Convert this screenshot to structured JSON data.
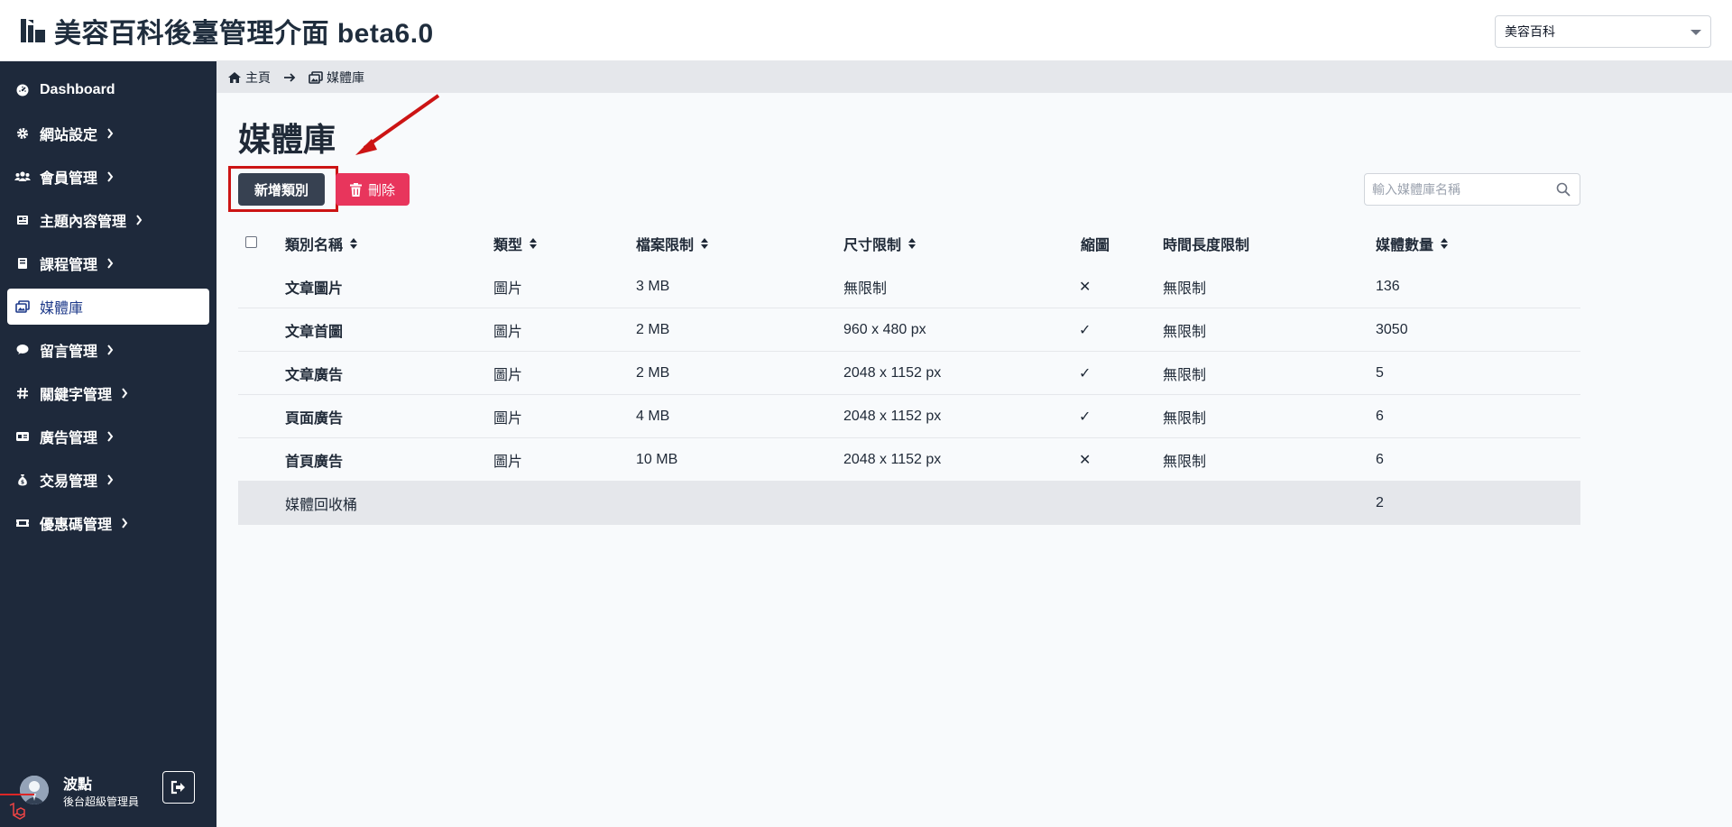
{
  "app": {
    "title": "美容百科後臺管理介面 beta6.0",
    "site_selector": {
      "value": "美容百科"
    }
  },
  "sidebar": {
    "items": [
      {
        "label": "Dashboard",
        "icon": "dashboard-icon",
        "has_children": false
      },
      {
        "label": "網站設定",
        "icon": "gear-icon",
        "has_children": true
      },
      {
        "label": "會員管理",
        "icon": "users-icon",
        "has_children": true
      },
      {
        "label": "主題內容管理",
        "icon": "book-icon",
        "has_children": true
      },
      {
        "label": "課程管理",
        "icon": "course-icon",
        "has_children": true
      },
      {
        "label": "媒體庫",
        "icon": "images-icon",
        "has_children": false,
        "active": true
      },
      {
        "label": "留言管理",
        "icon": "comment-icon",
        "has_children": true
      },
      {
        "label": "關鍵字管理",
        "icon": "hashtag-icon",
        "has_children": true
      },
      {
        "label": "廣告管理",
        "icon": "ad-icon",
        "has_children": true
      },
      {
        "label": "交易管理",
        "icon": "money-bag-icon",
        "has_children": true
      },
      {
        "label": "優惠碼管理",
        "icon": "ticket-icon",
        "has_children": true
      }
    ],
    "user": {
      "name": "波點",
      "role": "後台超級管理員"
    }
  },
  "breadcrumb": [
    {
      "label": "主頁",
      "icon": "home-icon"
    },
    {
      "label": "媒體庫",
      "icon": "images-icon"
    }
  ],
  "main": {
    "title": "媒體庫",
    "add_button": "新增類別",
    "delete_button": "刪除",
    "search": {
      "placeholder": "輸入媒體庫名稱",
      "value": ""
    }
  },
  "table": {
    "columns": [
      "類別名稱",
      "類型",
      "檔案限制",
      "尺寸限制",
      "縮圖",
      "時間長度限制",
      "媒體數量"
    ],
    "sortable": [
      true,
      true,
      true,
      true,
      false,
      false,
      true
    ],
    "rows": [
      {
        "name": "文章圖片",
        "type": "圖片",
        "file_limit": "3 MB",
        "size_limit": "無限制",
        "thumbnail": "✕",
        "duration_limit": "無限制",
        "count": "136"
      },
      {
        "name": "文章首圖",
        "type": "圖片",
        "file_limit": "2 MB",
        "size_limit": "960 x 480 px",
        "thumbnail": "✓",
        "duration_limit": "無限制",
        "count": "3050"
      },
      {
        "name": "文章廣告",
        "type": "圖片",
        "file_limit": "2 MB",
        "size_limit": "2048 x 1152 px",
        "thumbnail": "✓",
        "duration_limit": "無限制",
        "count": "5"
      },
      {
        "name": "頁面廣告",
        "type": "圖片",
        "file_limit": "4 MB",
        "size_limit": "2048 x 1152 px",
        "thumbnail": "✓",
        "duration_limit": "無限制",
        "count": "6"
      },
      {
        "name": "首頁廣告",
        "type": "圖片",
        "file_limit": "10 MB",
        "size_limit": "2048 x 1152 px",
        "thumbnail": "✕",
        "duration_limit": "無限制",
        "count": "6"
      }
    ],
    "trash_row": {
      "name": "媒體回收桶",
      "count": "2"
    }
  },
  "colors": {
    "sidebar_bg": "#1e293b",
    "primary_button": "#374151",
    "danger_button": "#e8355c",
    "annotation_red": "#cc1414"
  }
}
